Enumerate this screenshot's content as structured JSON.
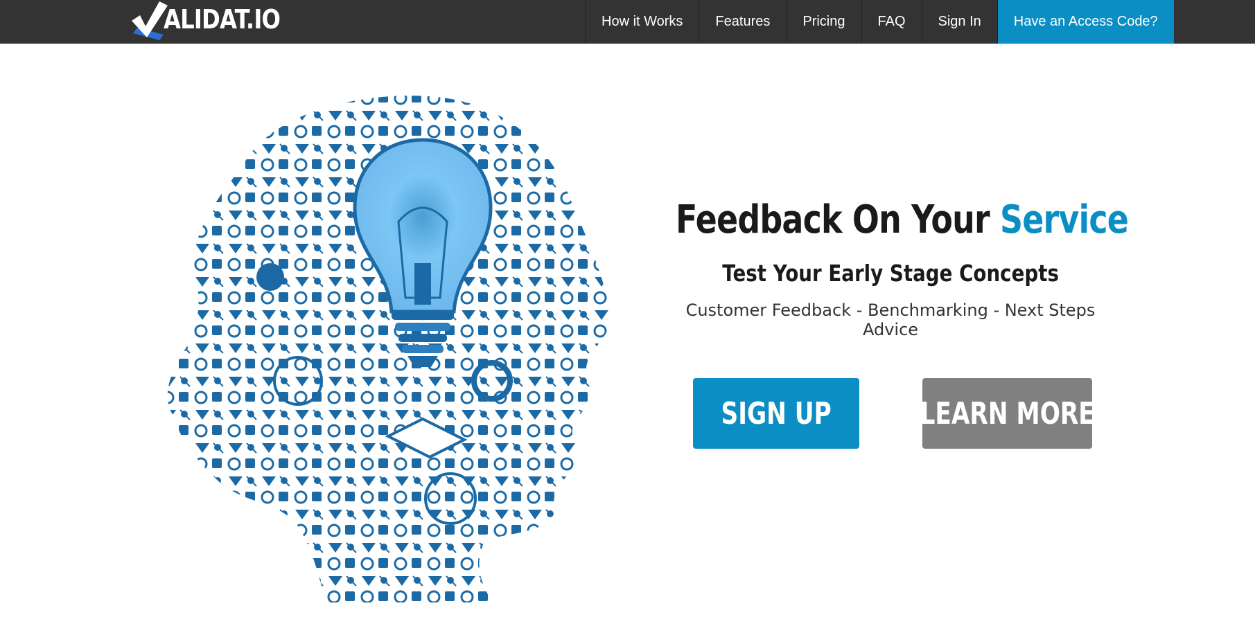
{
  "brand": {
    "logo_text": "ALIDAT.IO"
  },
  "nav": {
    "items": [
      {
        "label": "How it Works"
      },
      {
        "label": "Features"
      },
      {
        "label": "Pricing"
      },
      {
        "label": "FAQ"
      },
      {
        "label": "Sign In"
      }
    ],
    "cta_label": "Have an Access Code?"
  },
  "hero": {
    "headline_prefix": "Feedback On Your ",
    "headline_accent": "Service",
    "subhead": "Test Your Early Stage Concepts",
    "tagline": "Customer Feedback - Benchmarking - Next Steps Advice",
    "signup_label": "SIGN UP",
    "learn_more_label": "LEARN MORE",
    "image_icon": "head-of-science-icons-with-lightbulb"
  },
  "colors": {
    "navbar_bg": "#333333",
    "accent": "#0a8ec4",
    "secondary_button": "#808080",
    "icon_blue": "#1b6aa5",
    "bulb_light": "#7cc6f5"
  }
}
